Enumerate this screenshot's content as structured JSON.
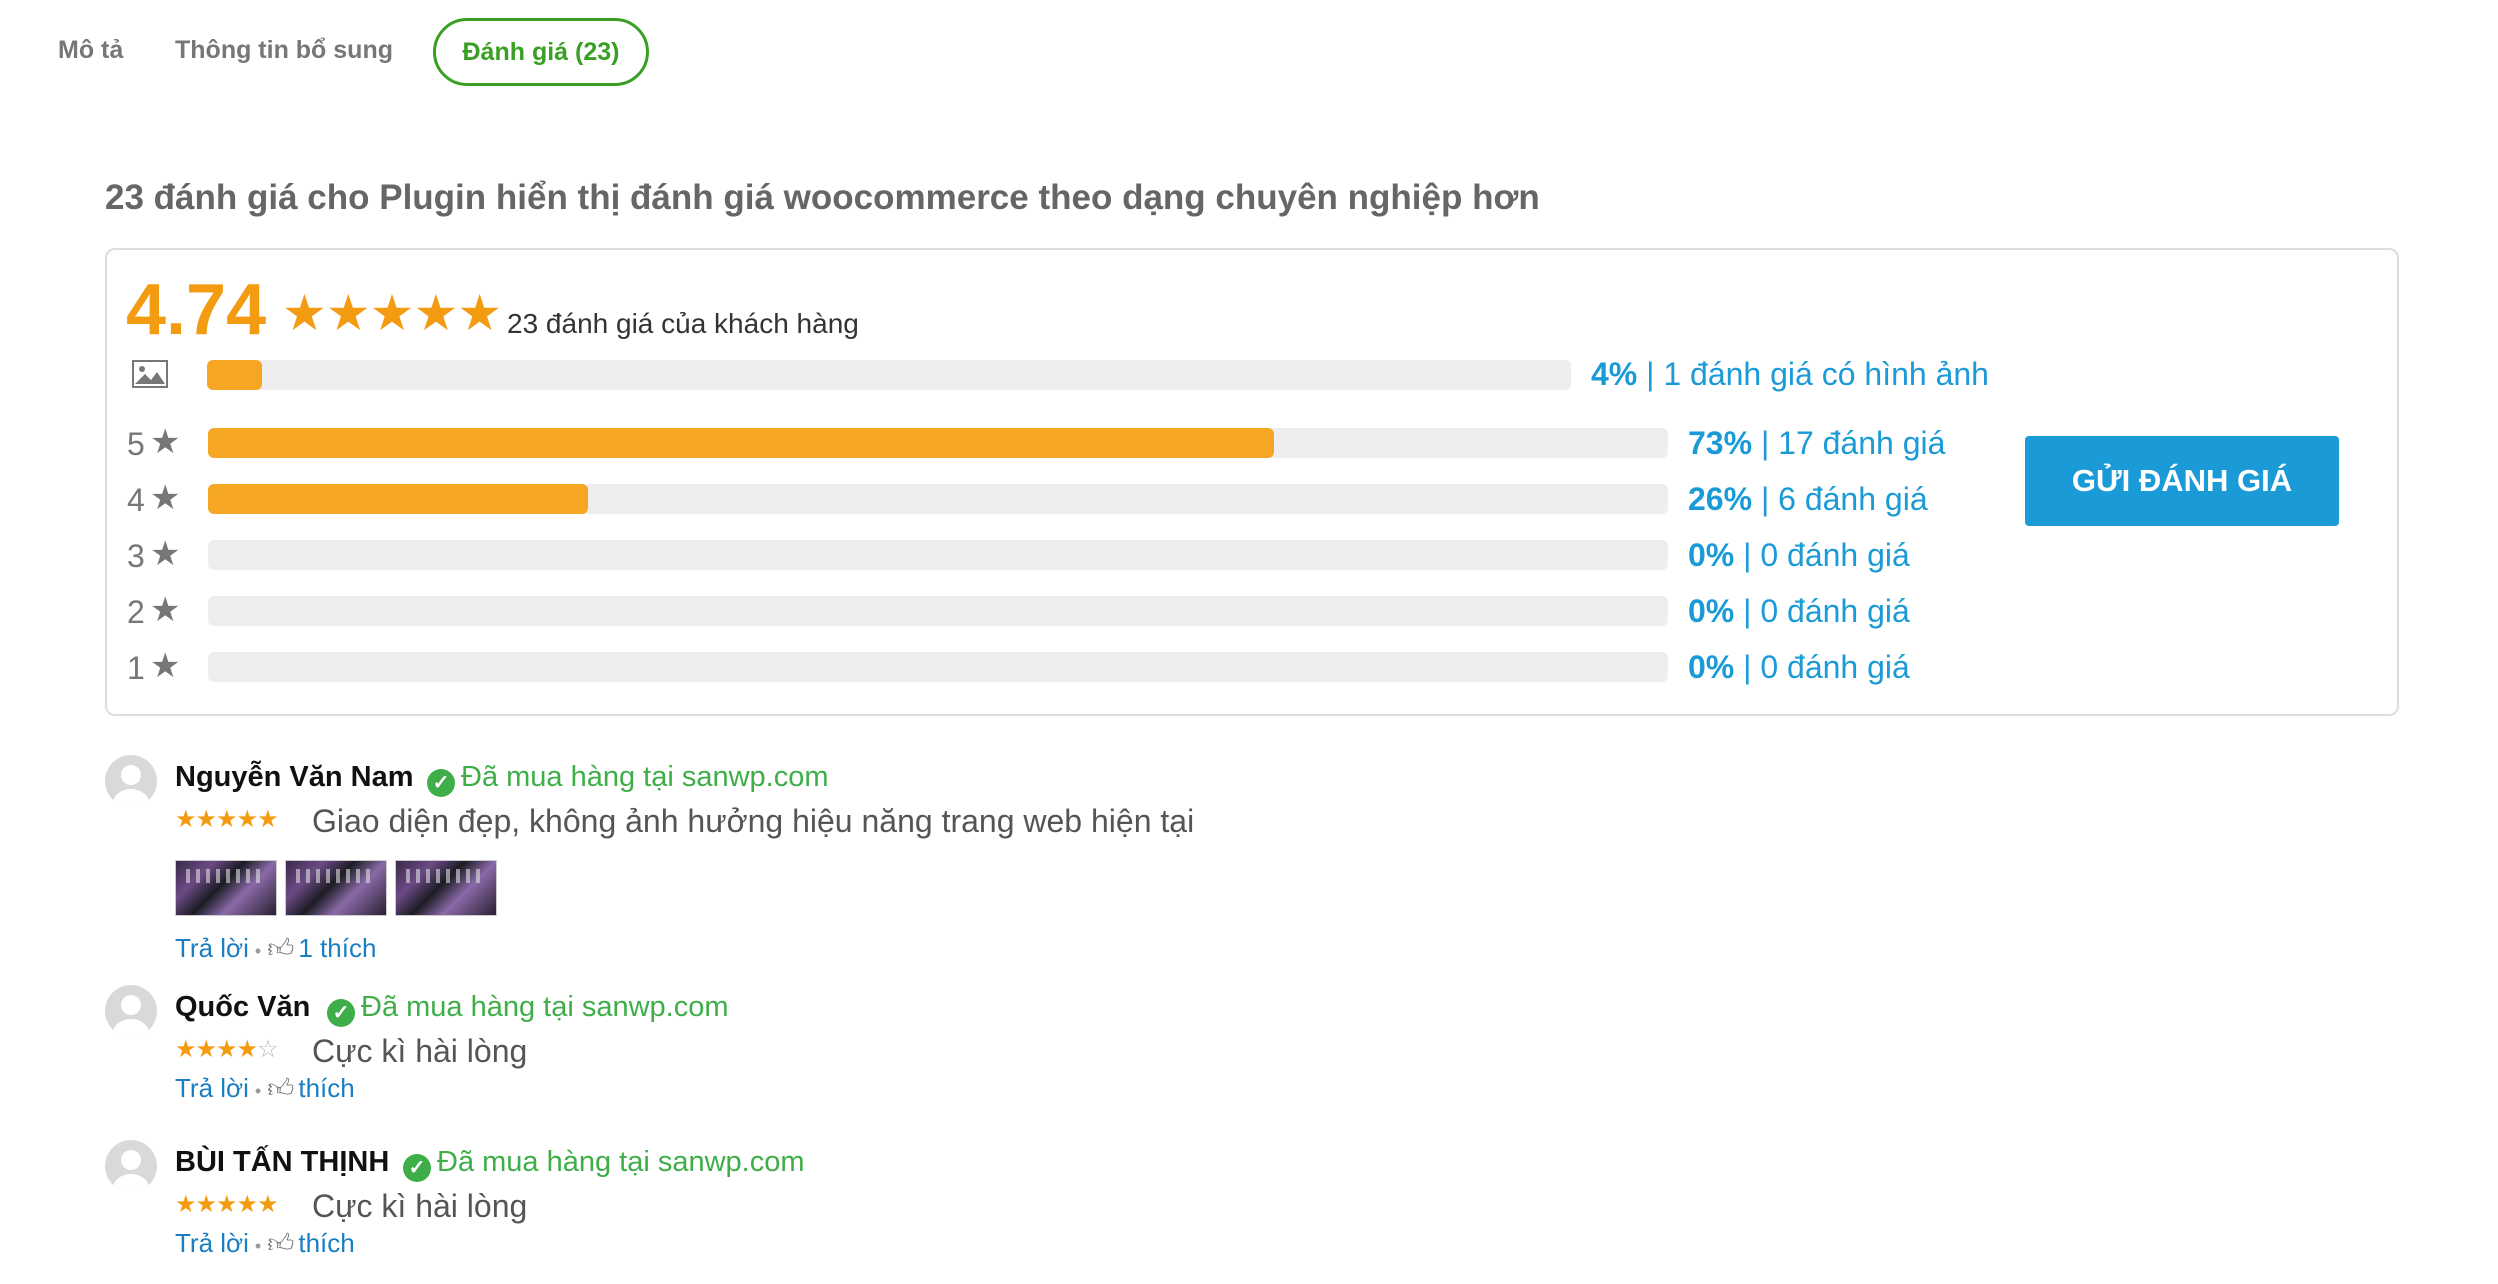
{
  "tabs": [
    {
      "label": "Mô tả",
      "active": false
    },
    {
      "label": "Thông tin bổ sung",
      "active": false
    },
    {
      "label": "Đánh giá (23)",
      "active": true
    }
  ],
  "heading": "23 đánh giá cho Plugin hiển thị đánh giá woocommerce theo dạng chuyên nghiệp hơn",
  "summary": {
    "average": "4.74",
    "average_stars": 5,
    "count_text": "23 đánh giá của khách hàng",
    "with_images": {
      "percent": "4%",
      "fill": 0.04,
      "text": " | 1 đánh giá có hình ảnh"
    },
    "rows": [
      {
        "star": "5",
        "percent": "73%",
        "fill": 0.73,
        "text": " | 17 đánh giá"
      },
      {
        "star": "4",
        "percent": "26%",
        "fill": 0.26,
        "text": " | 6 đánh giá"
      },
      {
        "star": "3",
        "percent": "0%",
        "fill": 0.0,
        "text": " | 0 đánh giá"
      },
      {
        "star": "2",
        "percent": "0%",
        "fill": 0.0,
        "text": " | 0 đánh giá"
      },
      {
        "star": "1",
        "percent": "0%",
        "fill": 0.0,
        "text": " | 0 đánh giá"
      }
    ],
    "submit_label": "GỬI ĐÁNH GIÁ"
  },
  "reviews": [
    {
      "name": "Nguyễn Văn Nam",
      "verified": "Đã mua hàng tại sanwp.com",
      "rating": 5,
      "text": "Giao diện đẹp, không ảnh hưởng hiệu năng trang web hiện tại",
      "images": 3,
      "reply": "Trả lời",
      "like": "1 thích"
    },
    {
      "name": "Quốc Văn",
      "verified": "Đã mua hàng tại sanwp.com",
      "rating": 4,
      "text": "Cực kì hài lòng",
      "images": 0,
      "reply": "Trả lời",
      "like": "thích"
    },
    {
      "name": "BÙI TẤN THỊNH",
      "verified": "Đã mua hàng tại sanwp.com",
      "rating": 5,
      "text": "Cực kì hài lòng",
      "images": 0,
      "reply": "Trả lời",
      "like": "thích"
    }
  ],
  "colors": {
    "accent": "#f5a623",
    "link": "#1a9ad6",
    "verified": "#3fae49",
    "tab_active": "#3aa023"
  }
}
